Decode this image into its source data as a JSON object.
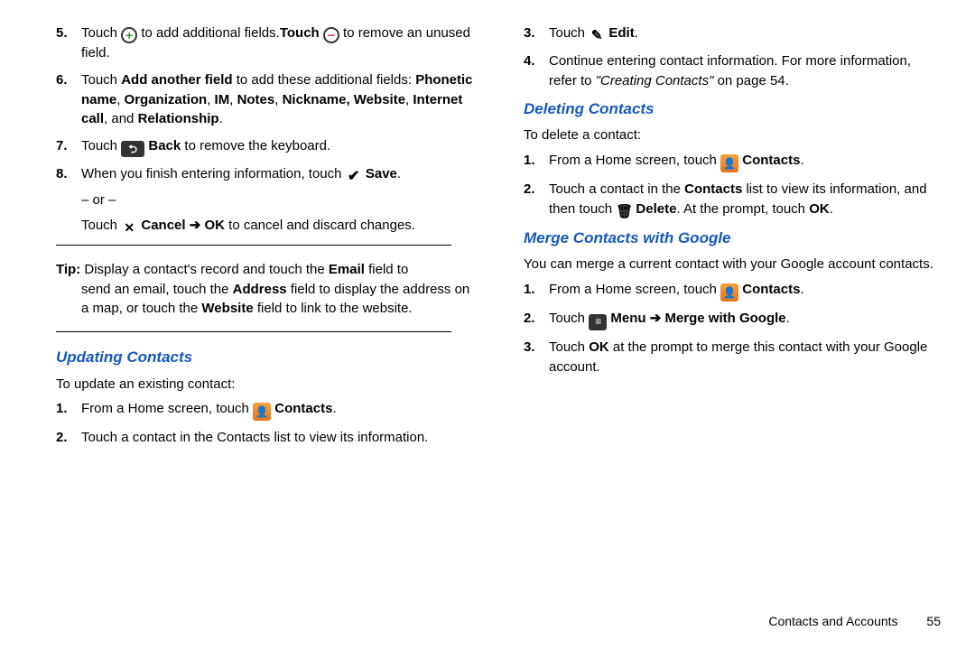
{
  "left": {
    "items5_a": "Touch ",
    "items5_b": " to add additional fields.",
    "items5_touch": "Touch ",
    "items5_c": " to remove an unused field.",
    "items6_a": "Touch ",
    "items6_b": "Add another field",
    "items6_c": " to add these additional fields: ",
    "items6_d": "Phonetic name",
    "items6_e": "Organization",
    "items6_f": "IM",
    "items6_g": "Notes",
    "items6_h": "Nickname, Website",
    "items6_i": "Internet call",
    "items6_j": "Relationship",
    "items7_a": "Touch ",
    "items7_b": "Back",
    "items7_c": " to remove the keyboard.",
    "items8_a": "When you finish entering information, touch ",
    "items8_b": "Save",
    "items8_or": "– or –",
    "items8_c": "Touch ",
    "items8_d": "Cancel",
    "items8_arrow": " ➔ ",
    "items8_e": "OK",
    "items8_f": " to cancel and discard changes.",
    "tip_lbl": "Tip:",
    "tip_a": " Display a contact's record and touch the ",
    "tip_b": "Email",
    "tip_c": " field to",
    "tip_rest_a": "send an email, touch the ",
    "tip_rest_b": "Address",
    "tip_rest_c": " field to display the address on a map, or touch the ",
    "tip_rest_d": "Website",
    "tip_rest_e": " field to link to the website.",
    "sec_update": "Updating Contacts",
    "update_lead": "To update an existing contact:",
    "upd1_a": "From a Home screen, touch ",
    "upd1_b": "Contacts",
    "upd2": "Touch a contact in the Contacts list to view its information."
  },
  "right": {
    "r3_a": "Touch ",
    "r3_b": "Edit",
    "r4_a": "Continue entering contact information. For more information, refer to ",
    "r4_b": "\"Creating Contacts\"",
    "r4_c": " on page 54.",
    "sec_delete": "Deleting Contacts",
    "del_lead": "To delete a contact:",
    "d1_a": "From a Home screen, touch ",
    "d1_b": "Contacts",
    "d2_a": "Touch a contact in the ",
    "d2_b": "Contacts",
    "d2_c": " list to view its information, and then touch ",
    "d2_d": "Delete",
    "d2_e": ". At the prompt, touch ",
    "d2_f": "OK",
    "sec_merge": "Merge Contacts with Google",
    "merge_lead": "You can merge a current contact with your Google account contacts.",
    "m1_a": "From a Home screen, touch ",
    "m1_b": "Contacts",
    "m2_a": "Touch ",
    "m2_b": "Menu",
    "m2_arrow": " ➔ ",
    "m2_c": "Merge with Google",
    "m3_a": "Touch ",
    "m3_b": "OK",
    "m3_c": " at the prompt to merge this contact with your Google account."
  },
  "footer": {
    "section": "Contacts and Accounts",
    "page": "55"
  },
  "nums": {
    "n1": "1.",
    "n2": "2.",
    "n3": "3.",
    "n4": "4.",
    "n5": "5.",
    "n6": "6.",
    "n7": "7.",
    "n8": "8."
  }
}
